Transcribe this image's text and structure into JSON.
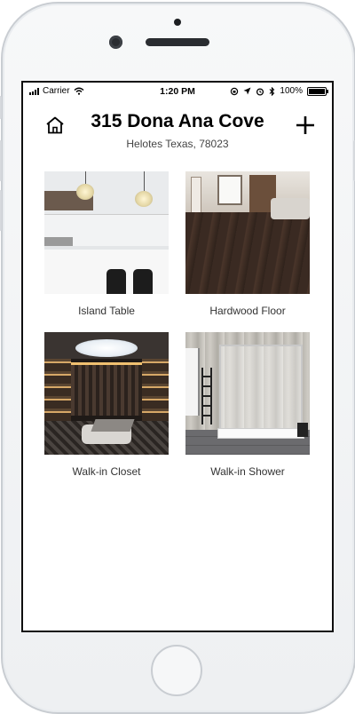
{
  "status_bar": {
    "carrier": "Carrier",
    "time": "1:20 PM",
    "battery_text": "100%"
  },
  "header": {
    "title": "315 Dona Ana Cove",
    "subtitle": "Helotes Texas, 78023",
    "home_icon": "home-icon",
    "add_icon": "plus-icon"
  },
  "rooms": [
    {
      "label": "Island Table"
    },
    {
      "label": "Hardwood Floor"
    },
    {
      "label": "Walk-in Closet"
    },
    {
      "label": "Walk-in Shower"
    }
  ]
}
